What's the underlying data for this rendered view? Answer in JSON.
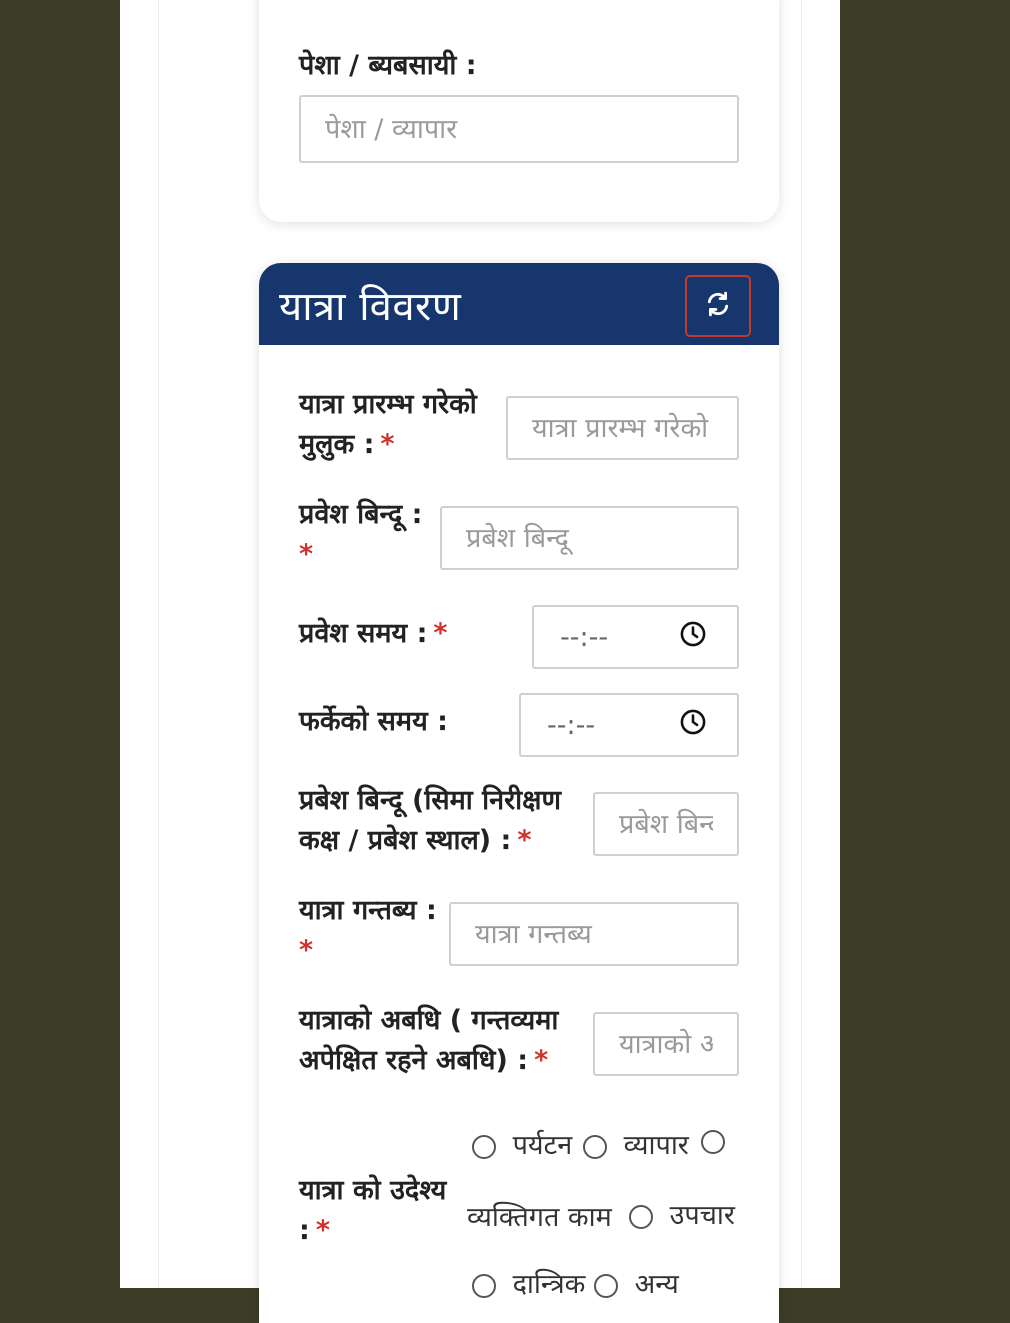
{
  "occupation": {
    "label": "पेशा / ब्यबसायी :",
    "placeholder": "पेशा / व्यापार"
  },
  "travel": {
    "title": "यात्रा विवरण",
    "reset_icon": "refresh-icon",
    "origin_country": {
      "label_line1": "यात्रा प्रारम्भ गरेको",
      "label_line2": "मुलुक :",
      "placeholder": "यात्रा प्रारम्भ गरेको"
    },
    "entry_point": {
      "label_line1": "प्रवेश बिन्दू :",
      "placeholder": "प्रबेश बिन्दू"
    },
    "entry_time": {
      "label": "प्रवेश समय :",
      "value": "--:--"
    },
    "return_time": {
      "label": "फर्केको समय :",
      "value": "--:--"
    },
    "checkpoint": {
      "label_line1": "प्रबेश बिन्दू (सिमा निरीक्षण",
      "label_line2": "कक्ष / प्रबेश स्थाल) :",
      "placeholder": "प्रबेश बिन्दू"
    },
    "destination": {
      "label_line1": "यात्रा गन्तब्य :",
      "placeholder": "यात्रा गन्तब्य"
    },
    "duration": {
      "label_line1": "यात्राको अबधि ( गन्तव्यमा",
      "label_line2": "अपेक्षित रहने अबधि) :",
      "placeholder": "यात्राको अबधि"
    },
    "purpose": {
      "label_line1": "यात्रा को उदेश्य",
      "label_line2": ":",
      "options": [
        "पर्यटन",
        "व्यापार",
        "व्यक्तिगत काम",
        "उपचार",
        "दान्त्रिक",
        "अन्य"
      ]
    }
  },
  "required_mark": "*",
  "colors": {
    "header": "#17366e",
    "required": "#d0312d",
    "background": "#3c3c27"
  }
}
